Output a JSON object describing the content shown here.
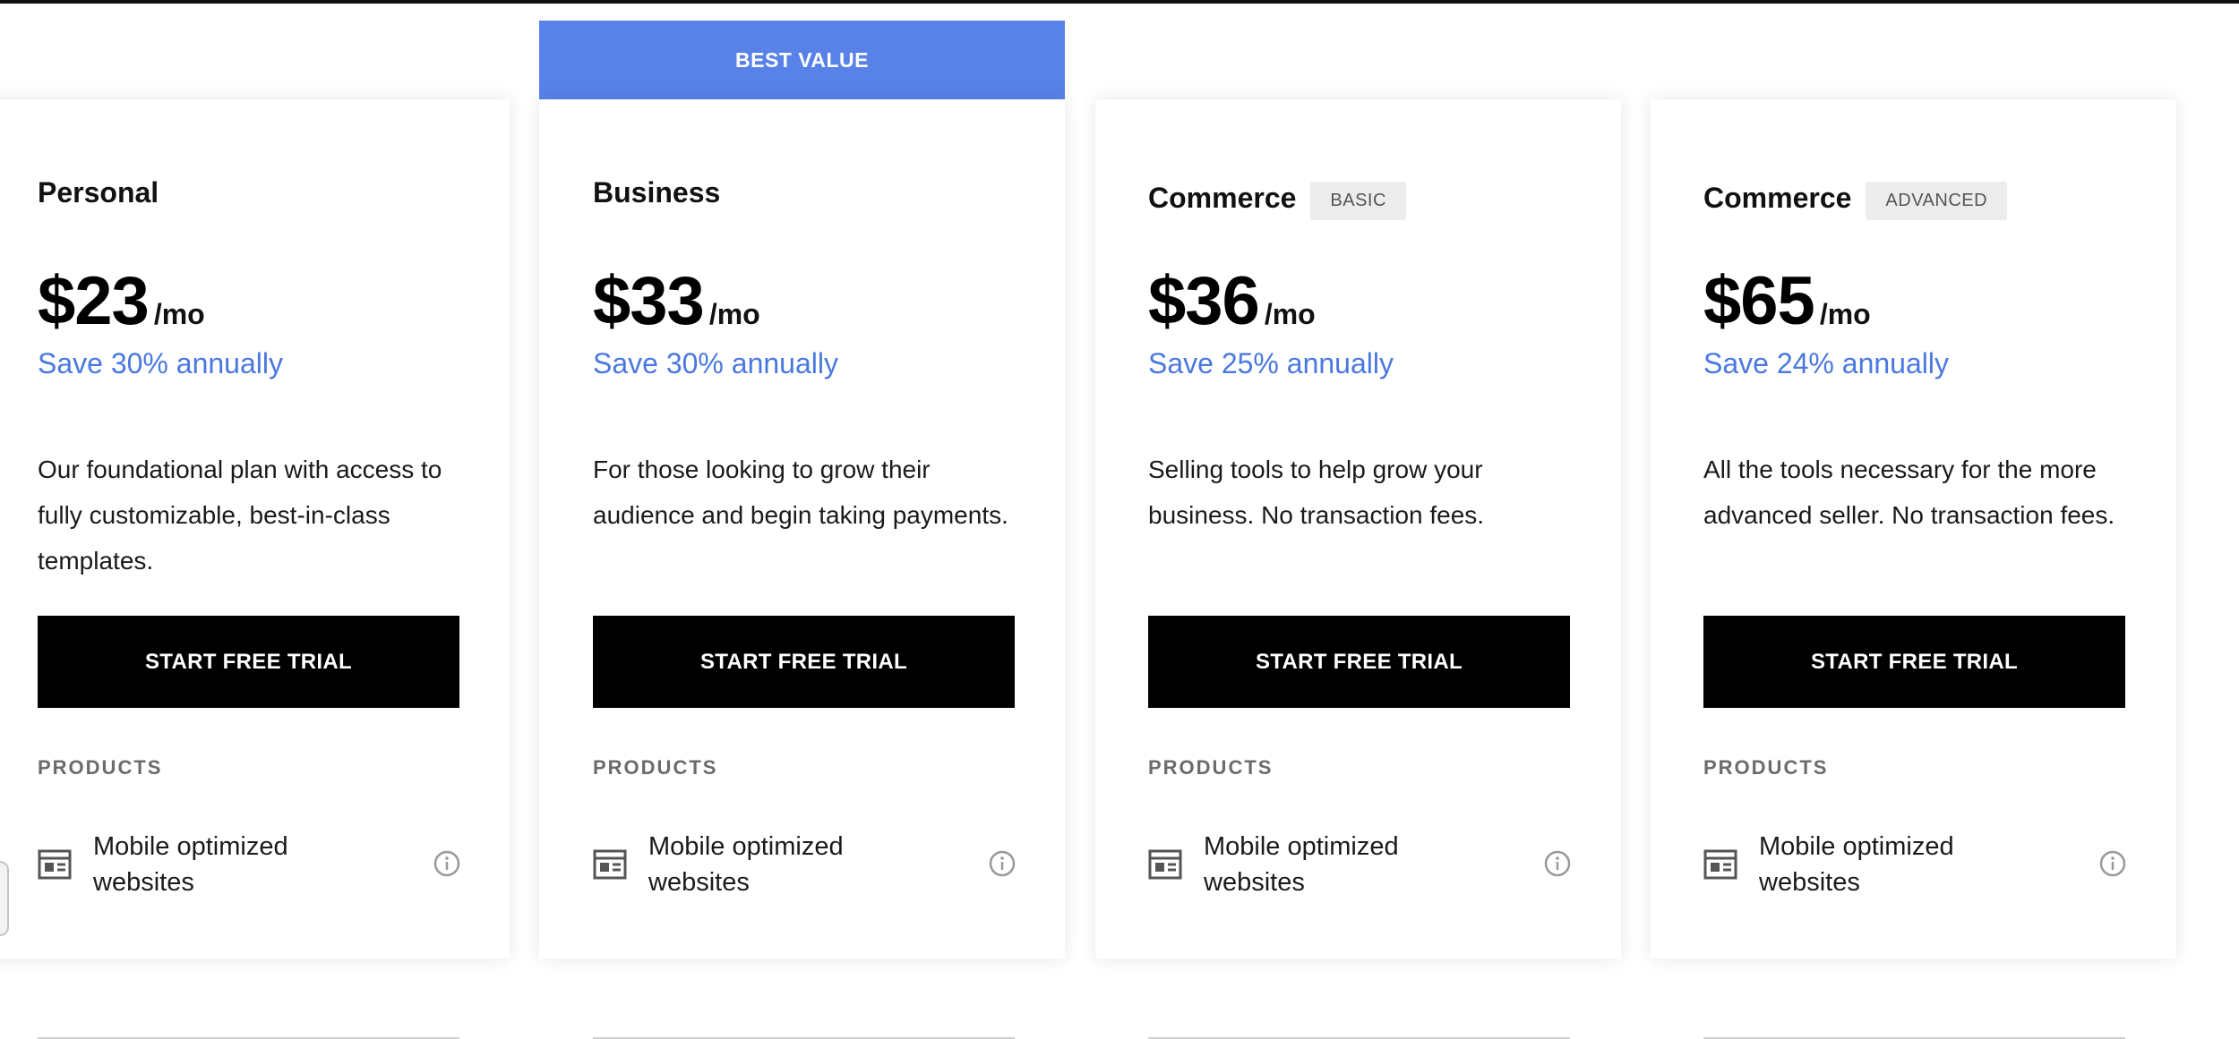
{
  "banner": {
    "label": "BEST VALUE"
  },
  "colors": {
    "accent": "#5882e8",
    "save_text": "#4a78e0",
    "cta_bg": "#000000",
    "badge_bg": "#ececec"
  },
  "plans": [
    {
      "name": "Personal",
      "badge": "",
      "price": "$23",
      "period": "/mo",
      "save": "Save 30% annually",
      "description": "Our foundational plan with access to fully customizable, best-in-class templates.",
      "cta": "START FREE TRIAL",
      "section": "PRODUCTS",
      "feature": {
        "label": "Mobile optimized websites",
        "icon": "website-layout-icon",
        "info_icon": "info-icon"
      }
    },
    {
      "name": "Business",
      "badge": "",
      "price": "$33",
      "period": "/mo",
      "save": "Save 30% annually",
      "description": "For those looking to grow their audience and begin taking payments.",
      "cta": "START FREE TRIAL",
      "section": "PRODUCTS",
      "feature": {
        "label": "Mobile optimized websites",
        "icon": "website-layout-icon",
        "info_icon": "info-icon"
      }
    },
    {
      "name": "Commerce",
      "badge": "BASIC",
      "price": "$36",
      "period": "/mo",
      "save": "Save 25% annually",
      "description": "Selling tools to help grow your business. No transaction fees.",
      "cta": "START FREE TRIAL",
      "section": "PRODUCTS",
      "feature": {
        "label": "Mobile optimized websites",
        "icon": "website-layout-icon",
        "info_icon": "info-icon"
      }
    },
    {
      "name": "Commerce",
      "badge": "ADVANCED",
      "price": "$65",
      "period": "/mo",
      "save": "Save 24% annually",
      "description": "All the tools necessary for the more advanced seller. No transaction fees.",
      "cta": "START FREE TRIAL",
      "section": "PRODUCTS",
      "feature": {
        "label": "Mobile optimized websites",
        "icon": "website-layout-icon",
        "info_icon": "info-icon"
      }
    }
  ]
}
